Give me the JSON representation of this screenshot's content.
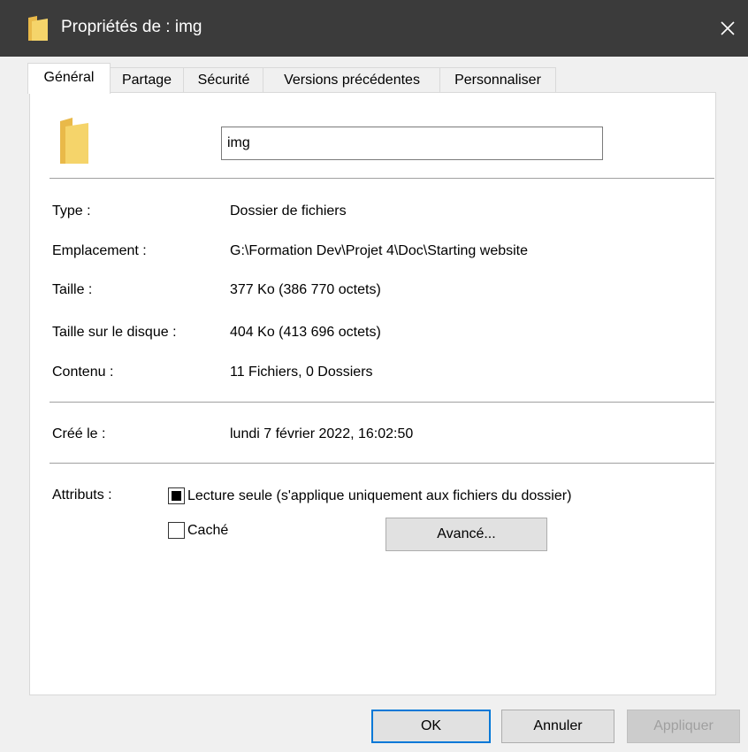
{
  "window": {
    "title": "Propriétés de : img",
    "close_symbol": "✕"
  },
  "tabs": [
    {
      "label": "Général"
    },
    {
      "label": "Partage"
    },
    {
      "label": "Sécurité"
    },
    {
      "label": "Versions précédentes"
    },
    {
      "label": "Personnaliser"
    }
  ],
  "general": {
    "name_value": "img",
    "properties": [
      {
        "label": "Type :",
        "value": "Dossier de fichiers"
      },
      {
        "label": "Emplacement :",
        "value": "G:\\Formation Dev\\Projet 4\\Doc\\Starting website"
      },
      {
        "label": "Taille :",
        "value": "377 Ko (386 770 octets)"
      },
      {
        "label": "Taille sur le disque :",
        "value": "404 Ko (413 696 octets)"
      },
      {
        "label": "Contenu :",
        "value": "11 Fichiers, 0 Dossiers"
      }
    ],
    "created": {
      "label": "Créé le :",
      "value": "lundi 7 février 2022, 16:02:50"
    },
    "attributes": {
      "label": "Attributs :",
      "readonly_label": "Lecture seule (s'applique uniquement aux fichiers du dossier)",
      "readonly_state": "indeterminate",
      "hidden_label": "Caché",
      "hidden_checked": false,
      "advanced_label": "Avancé..."
    }
  },
  "buttons": {
    "ok": "OK",
    "cancel": "Annuler",
    "apply": "Appliquer"
  },
  "colors": {
    "titlebar": "#3b3b3b",
    "folder": "#f5d46a",
    "accent": "#0078d7"
  },
  "icons": {
    "window": "folder-icon",
    "close": "close-icon",
    "folder": "folder-icon"
  }
}
